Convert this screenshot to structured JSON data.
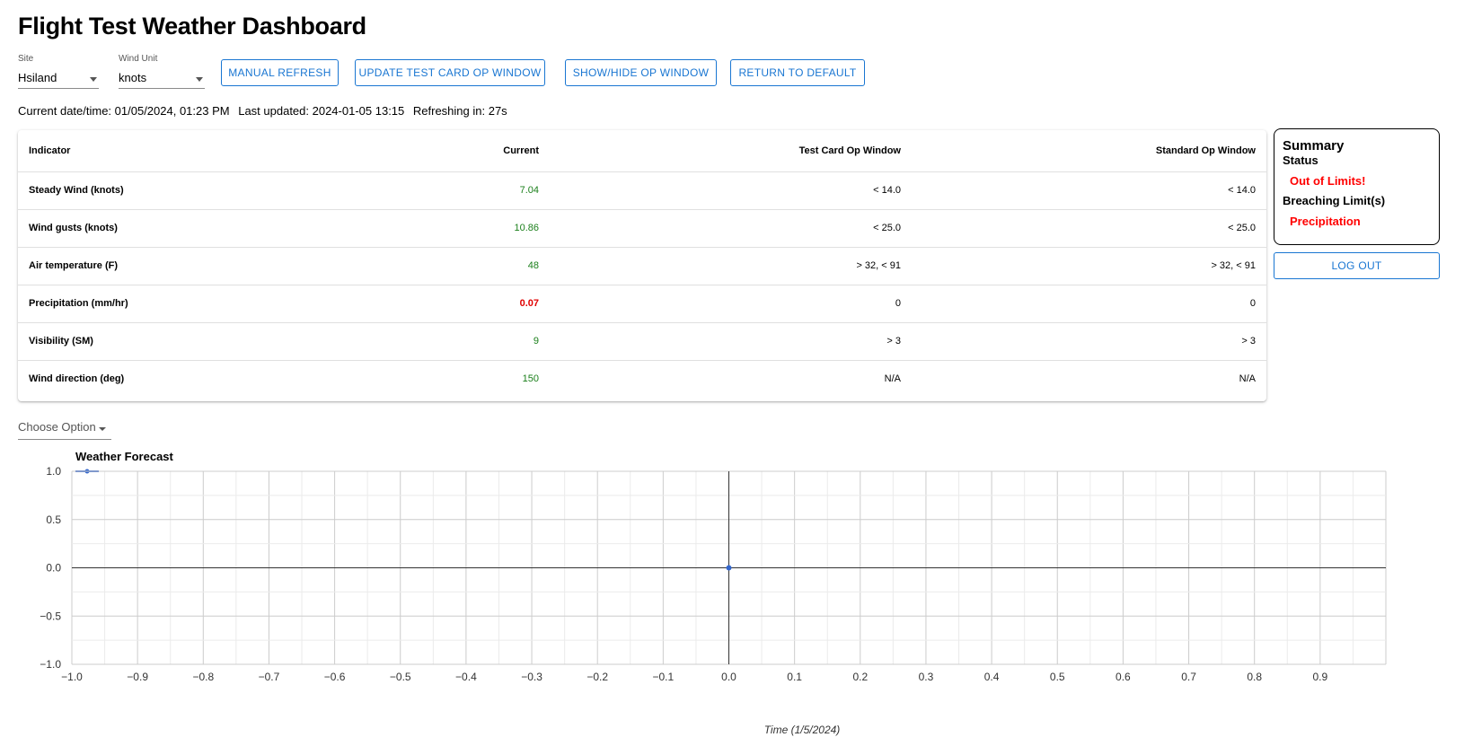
{
  "header": {
    "title": "Flight Test Weather Dashboard"
  },
  "controls": {
    "site": {
      "label": "Site",
      "value": "Hsiland"
    },
    "wind_unit": {
      "label": "Wind Unit",
      "value": "knots"
    },
    "buttons": {
      "manual_refresh": "MANUAL REFRESH",
      "update_test_card": "UPDATE TEST CARD OP WINDOW",
      "show_hide": "SHOW/HIDE OP WINDOW",
      "return_default": "RETURN TO DEFAULT"
    }
  },
  "status": {
    "current": "Current date/time: 01/05/2024, 01:23 PM",
    "updated": "Last updated: 2024-01-05 13:15",
    "refreshing": "Refreshing in: 27s"
  },
  "table": {
    "headers": [
      "Indicator",
      "Current",
      "Test Card Op Window",
      "Standard Op Window"
    ],
    "rows": [
      {
        "indicator": "Steady Wind (knots)",
        "current": "7.04",
        "test": "< 14.0",
        "standard": "< 14.0",
        "status": "ok"
      },
      {
        "indicator": "Wind gusts (knots)",
        "current": "10.86",
        "test": "< 25.0",
        "standard": "< 25.0",
        "status": "ok"
      },
      {
        "indicator": "Air temperature (F)",
        "current": "48",
        "test": "> 32, < 91",
        "standard": "> 32, < 91",
        "status": "ok"
      },
      {
        "indicator": "Precipitation (mm/hr)",
        "current": "0.07",
        "test": "0",
        "standard": "0",
        "status": "bad"
      },
      {
        "indicator": "Visibility (SM)",
        "current": "9",
        "test": "> 3",
        "standard": "> 3",
        "status": "ok"
      },
      {
        "indicator": "Wind direction (deg)",
        "current": "150",
        "test": "N/A",
        "standard": "N/A",
        "status": "ok"
      }
    ]
  },
  "summary": {
    "title": "Summary",
    "status_label": "Status",
    "status_value": "Out of Limits!",
    "breaching_label": "Breaching Limit(s)",
    "breaching_value": "Precipitation",
    "logout": "LOG OUT"
  },
  "choose_option": "Choose Option",
  "colors": {
    "accent": "#1976d2",
    "ok": "#1a7f1a",
    "bad": "#e00000",
    "series": "#3366cc"
  },
  "chart_data": {
    "type": "line",
    "title": "Weather Forecast",
    "xlabel": "Time (1/5/2024)",
    "ylabel": "",
    "xlim": [
      -1.0,
      1.0
    ],
    "ylim": [
      -1.0,
      1.0
    ],
    "x_ticks": [
      "−1.0",
      "−0.9",
      "−0.8",
      "−0.7",
      "−0.6",
      "−0.5",
      "−0.4",
      "−0.3",
      "−0.2",
      "−0.1",
      "0.0",
      "0.1",
      "0.2",
      "0.3",
      "0.4",
      "0.5",
      "0.6",
      "0.7",
      "0.8",
      "0.9"
    ],
    "y_ticks": [
      "1.0",
      "0.5",
      "0.0",
      "−0.5",
      "−1.0"
    ],
    "grid": true,
    "legend": "top-left",
    "series": [
      {
        "x": [
          0.0
        ],
        "y": [
          0.0
        ],
        "color": "#3366cc"
      }
    ]
  }
}
